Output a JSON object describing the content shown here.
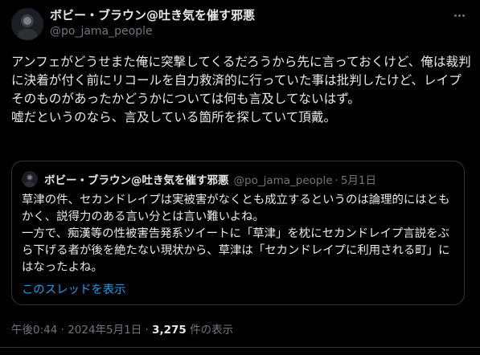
{
  "author": {
    "display_name": "ボビー・ブラウン@吐き気を催す邪悪",
    "handle": "@po_jama_people"
  },
  "tweet": {
    "paragraphs": [
      "アンフェがどうせまた俺に突撃してくるだろうから先に言っておくけど、俺は裁判に決着が付く前にリコールを自力救済的に行っていた事は批判したけど、レイプそのものがあったかどうかについては何も言及してないはず。",
      "嘘だというのなら、言及している箇所を探していて頂戴。"
    ]
  },
  "quoted_tweet": {
    "display_name": "ボビー・ブラウン@吐き気を催す邪悪",
    "handle": "@po_jama_people",
    "separator": "·",
    "date": "5月1日",
    "paragraphs": [
      "草津の件、セカンドレイプは実被害がなくとも成立するというのは論理的にはともかく、説得力のある言い分とは言い難いよね。",
      "一方で、痴漢等の性被害告発系ツイートに「草津」を枕にセカンドレイプ言説をぶら下げる者が後を絶たない現状から、草津は「セカンドレイプに利用される町」にはなったよね。"
    ],
    "show_thread_label": "このスレッドを表示"
  },
  "footer": {
    "time": "午後0:44",
    "separator1": " · ",
    "date": "2024年5月1日",
    "separator2": " · ",
    "views_count": "3,275",
    "views_label": " 件の表示"
  },
  "icons": {
    "avatar": "avatar-image",
    "more": "more-options-icon"
  }
}
